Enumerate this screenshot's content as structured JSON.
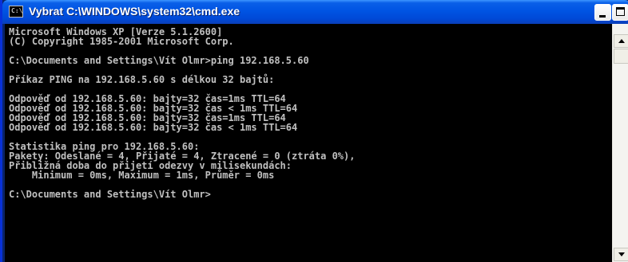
{
  "window": {
    "title": "Vybrat C:\\WINDOWS\\system32\\cmd.exe",
    "icon_text": "C:\\",
    "icon": "cmd-console-icon"
  },
  "console": {
    "lines": [
      "Microsoft Windows XP [Verze 5.1.2600]",
      "(C) Copyright 1985-2001 Microsoft Corp.",
      "",
      "C:\\Documents and Settings\\Vít Olmr>ping 192.168.5.60",
      "",
      "Příkaz PING na 192.168.5.60 s délkou 32 bajtů:",
      "",
      "Odpověď od 192.168.5.60: bajty=32 čas=1ms TTL=64",
      "Odpověď od 192.168.5.60: bajty=32 čas < 1ms TTL=64",
      "Odpověď od 192.168.5.60: bajty=32 čas=1ms TTL=64",
      "Odpověď od 192.168.5.60: bajty=32 čas < 1ms TTL=64",
      "",
      "Statistika ping pro 192.168.5.60:",
      "Pakety: Odeslané = 4, Přijaté = 4, Ztracené = 0 (ztráta 0%),",
      "Přibližná doba do přijetí odezvy v milisekundách:",
      "    Minimum = 0ms, Maximum = 1ms, Průměr = 0ms",
      "",
      "C:\\Documents and Settings\\Vít Olmr>"
    ]
  },
  "colors": {
    "titlebar": "#0054e3",
    "console_bg": "#000000",
    "console_fg": "#c0c0c0"
  }
}
